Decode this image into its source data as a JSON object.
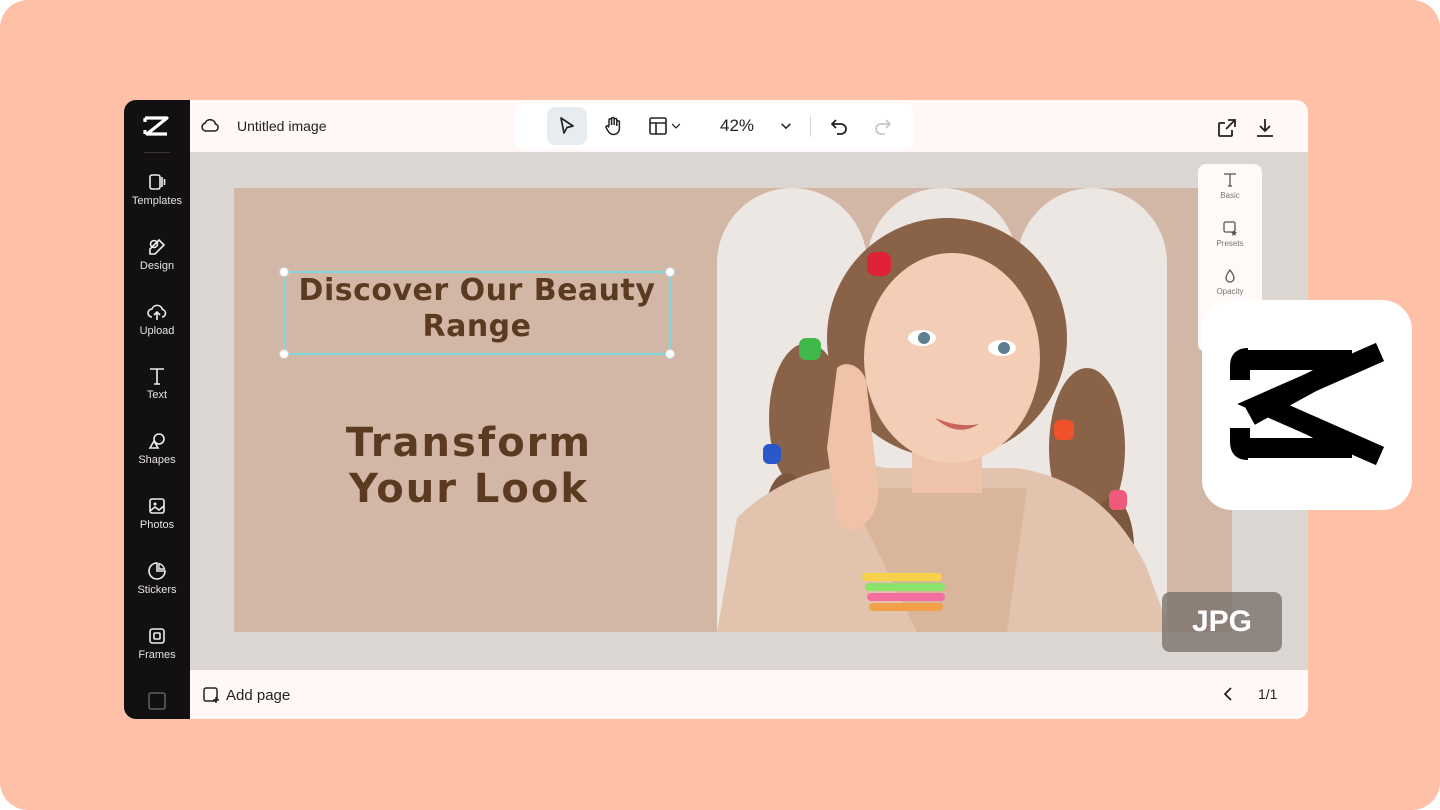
{
  "app": {
    "doc_title": "Untitled image"
  },
  "sidebar": {
    "items": [
      {
        "label": "Templates",
        "icon": "templates-icon"
      },
      {
        "label": "Design",
        "icon": "design-icon"
      },
      {
        "label": "Upload",
        "icon": "upload-icon"
      },
      {
        "label": "Text",
        "icon": "text-icon"
      },
      {
        "label": "Shapes",
        "icon": "shapes-icon"
      },
      {
        "label": "Photos",
        "icon": "photos-icon"
      },
      {
        "label": "Stickers",
        "icon": "stickers-icon"
      },
      {
        "label": "Frames",
        "icon": "frames-icon"
      }
    ]
  },
  "toolbar": {
    "zoom": "42%"
  },
  "canvas": {
    "headline": "Discover Our Beauty Range",
    "subhead_line1": "Transform",
    "subhead_line2": "Your Look"
  },
  "properties": {
    "items": [
      {
        "label": "Basic",
        "icon": "text-icon"
      },
      {
        "label": "Presets",
        "icon": "presets-icon"
      },
      {
        "label": "Opacity",
        "icon": "opacity-icon"
      }
    ]
  },
  "bottombar": {
    "add_page": "Add page",
    "page_count": "1/1"
  },
  "badge": {
    "format": "JPG"
  },
  "colors": {
    "backdrop": "#ffc0a8",
    "canvas_bg": "#d3b7a6",
    "headline_text": "#5b3a22",
    "selection": "#7ed9df",
    "sidebar_bg": "#121010"
  }
}
